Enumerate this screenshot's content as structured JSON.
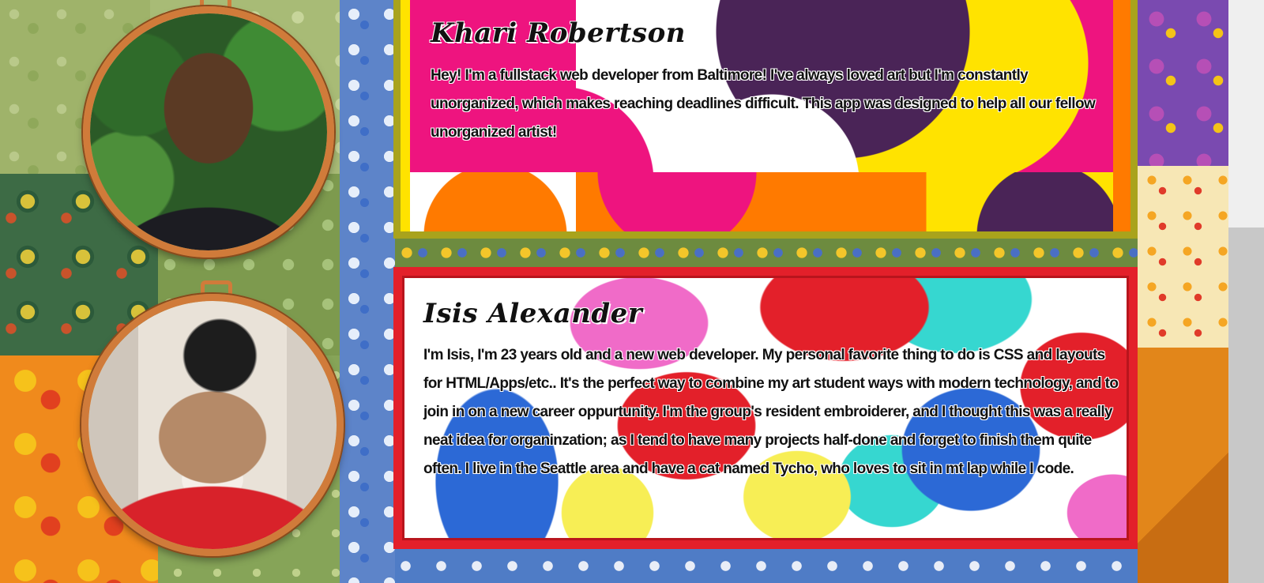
{
  "team": [
    {
      "name": "Khari Robertson",
      "bio": "Hey! I'm a fullstack web developer from Baltimore! I've always loved art but I'm constantly unorganized, which makes reaching deadlines difficult. This app was designed to help all our fellow unorganized artist!"
    },
    {
      "name": "Isis Alexander",
      "bio": "I'm Isis, I'm 23 years old and a new web developer. My personal favorite thing to do is CSS and layouts for HTML/Apps/etc.. It's the perfect way to combine my art student ways with modern technology, and to join in on a new career oppurtunity. I'm the group's resident embroiderer, and I thought this was a really neat idea for organinzation; as I tend to have many projects half-done and forget to finish them quite often. I live in the Seattle area and have a cat named Tycho, who loves to sit in mt lap while I code."
    }
  ],
  "colors": {
    "hoop": "#d07b3a",
    "khari_card_border": "#a9a31c",
    "isis_card_border": "#e3202a"
  }
}
